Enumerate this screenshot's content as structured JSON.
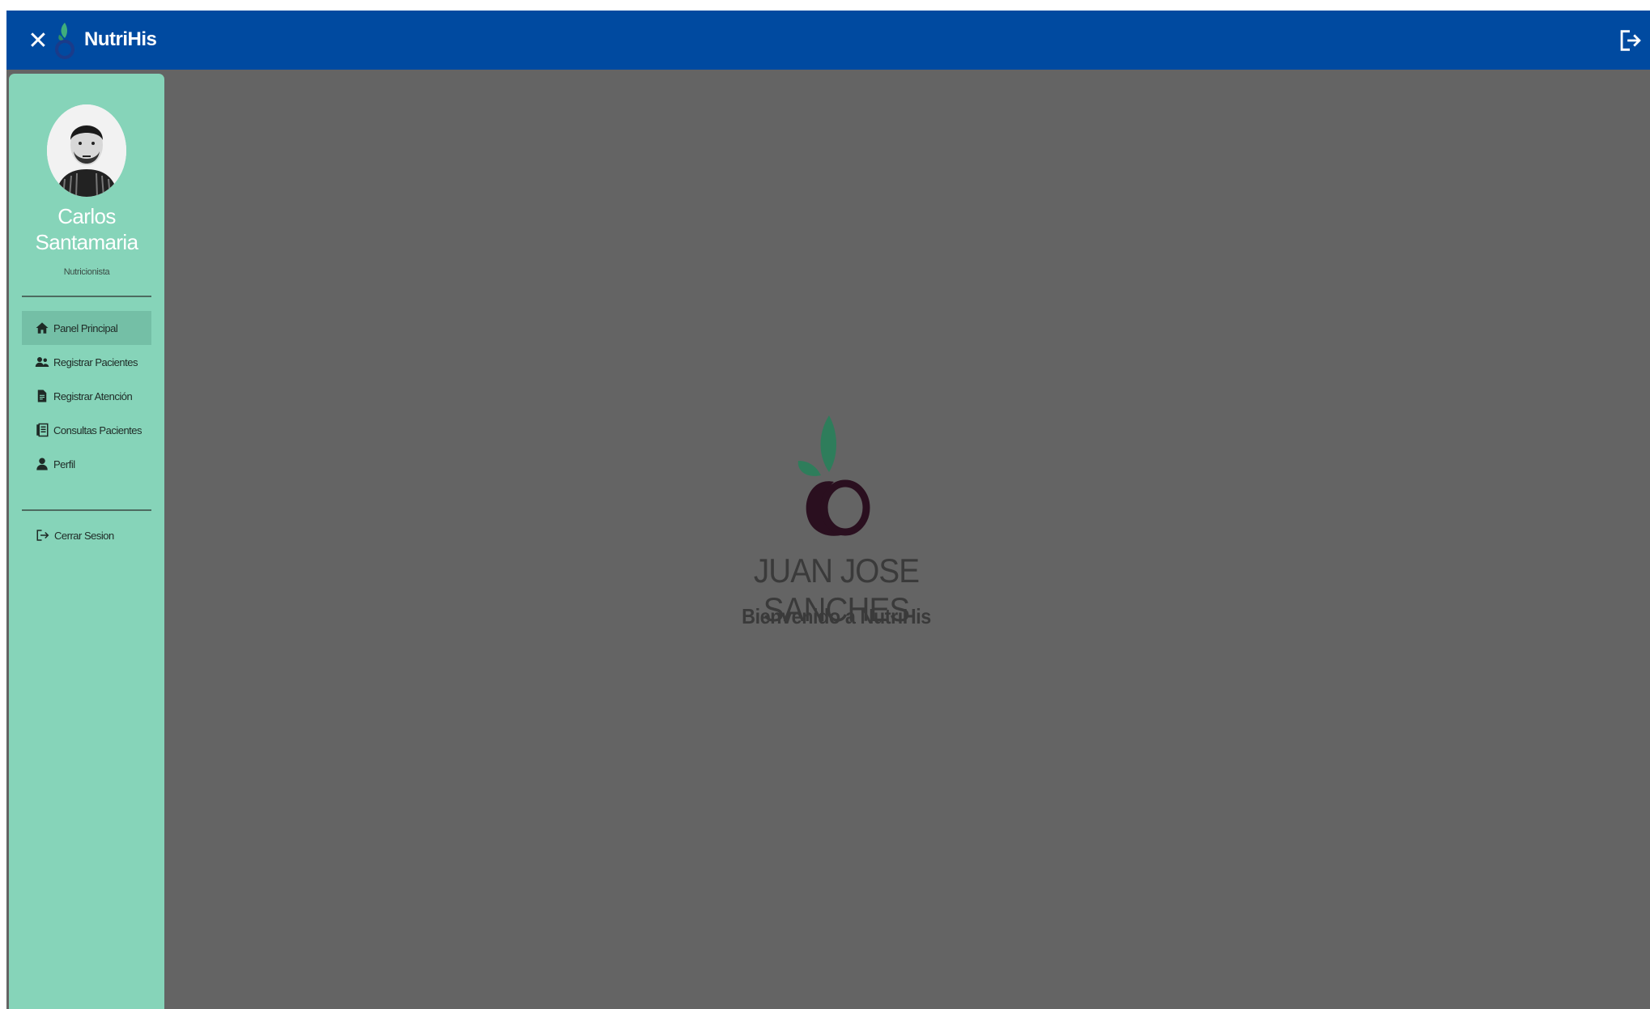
{
  "app": {
    "brand_name": "NutriHis"
  },
  "header": {
    "close_icon": "close-icon",
    "logout_icon": "logout-icon"
  },
  "sidebar": {
    "user_name": "Carlos Santamaria",
    "user_role": "Nutricionista",
    "items": [
      {
        "label": "Panel Principal",
        "icon": "home-icon",
        "active": true
      },
      {
        "label": "Registrar Pacientes",
        "icon": "users-icon",
        "active": false
      },
      {
        "label": "Registrar Atención",
        "icon": "document-icon",
        "active": false
      },
      {
        "label": "Consultas Pacientes",
        "icon": "records-icon",
        "active": false
      },
      {
        "label": "Perfil",
        "icon": "user-icon",
        "active": false
      }
    ],
    "logout_label": "Cerrar Sesion"
  },
  "main": {
    "patient_name": "JUAN JOSE SANCHES",
    "welcome_text": "Bienvenido a NutriHis"
  },
  "colors": {
    "topbar": "#004aa0",
    "sidebar": "#86d4b9",
    "sidebar_active": "#74bfa6",
    "overlay": "#646464",
    "logo_leaf": "#2e7d5b",
    "logo_fruit": "#2a0f1f"
  }
}
